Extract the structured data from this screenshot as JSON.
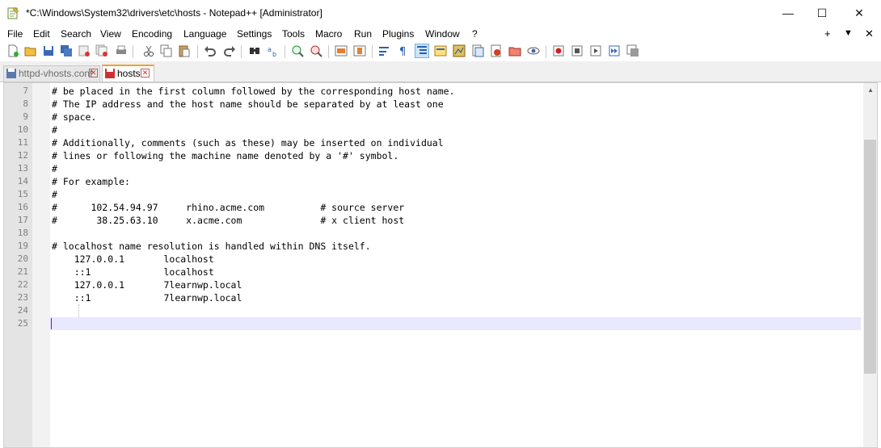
{
  "window": {
    "title": "*C:\\Windows\\System32\\drivers\\etc\\hosts - Notepad++ [Administrator]",
    "controls": {
      "minimize": "—",
      "maximize": "☐",
      "close": "✕"
    }
  },
  "menu": {
    "items": [
      "File",
      "Edit",
      "Search",
      "View",
      "Encoding",
      "Language",
      "Settings",
      "Tools",
      "Macro",
      "Run",
      "Plugins",
      "Window",
      "?"
    ],
    "right": {
      "plus": "+",
      "dropdown": "▼",
      "close": "✕"
    }
  },
  "toolbar": {
    "icons": [
      "new-file-icon",
      "open-file-icon",
      "save-icon",
      "save-all-icon",
      "close-icon",
      "close-all-icon",
      "print-icon",
      "cut-icon",
      "copy-icon",
      "paste-icon",
      "undo-icon",
      "redo-icon",
      "find-icon",
      "replace-icon",
      "zoom-in-icon",
      "zoom-out-icon",
      "sync-vertical-icon",
      "sync-horizontal-icon",
      "word-wrap-icon",
      "show-all-chars-icon",
      "indent-guide-icon",
      "language-udl-icon",
      "doc-map-icon",
      "function-list-icon",
      "folder-workspace-icon",
      "document-list-icon",
      "monitoring-icon",
      "record-macro-icon",
      "stop-record-icon",
      "play-macro-icon",
      "run-macro-multiple-icon",
      "save-macro-icon"
    ]
  },
  "tabs": [
    {
      "label": "httpd-vhosts.conf",
      "active": false
    },
    {
      "label": "hosts",
      "active": true
    }
  ],
  "editor": {
    "lines": [
      {
        "num": "7",
        "text": "# be placed in the first column followed by the corresponding host name."
      },
      {
        "num": "8",
        "text": "# The IP address and the host name should be separated by at least one"
      },
      {
        "num": "9",
        "text": "# space."
      },
      {
        "num": "10",
        "text": "#"
      },
      {
        "num": "11",
        "text": "# Additionally, comments (such as these) may be inserted on individual"
      },
      {
        "num": "12",
        "text": "# lines or following the machine name denoted by a '#' symbol."
      },
      {
        "num": "13",
        "text": "#"
      },
      {
        "num": "14",
        "text": "# For example:"
      },
      {
        "num": "15",
        "text": "#"
      },
      {
        "num": "16",
        "text": "#      102.54.94.97     rhino.acme.com          # source server"
      },
      {
        "num": "17",
        "text": "#       38.25.63.10     x.acme.com              # x client host"
      },
      {
        "num": "18",
        "text": ""
      },
      {
        "num": "19",
        "text": "# localhost name resolution is handled within DNS itself."
      },
      {
        "num": "20",
        "text": "    127.0.0.1       localhost"
      },
      {
        "num": "21",
        "text": "    ::1             localhost"
      },
      {
        "num": "22",
        "text": "    127.0.0.1       7learnwp.local"
      },
      {
        "num": "23",
        "text": "    ::1             7learnwp.local"
      },
      {
        "num": "24",
        "text": ""
      },
      {
        "num": "25",
        "text": ""
      }
    ]
  },
  "colors": {
    "accent_tab": "#f0a030",
    "caret": "#8000ff",
    "current_line": "#e8e8ff"
  }
}
